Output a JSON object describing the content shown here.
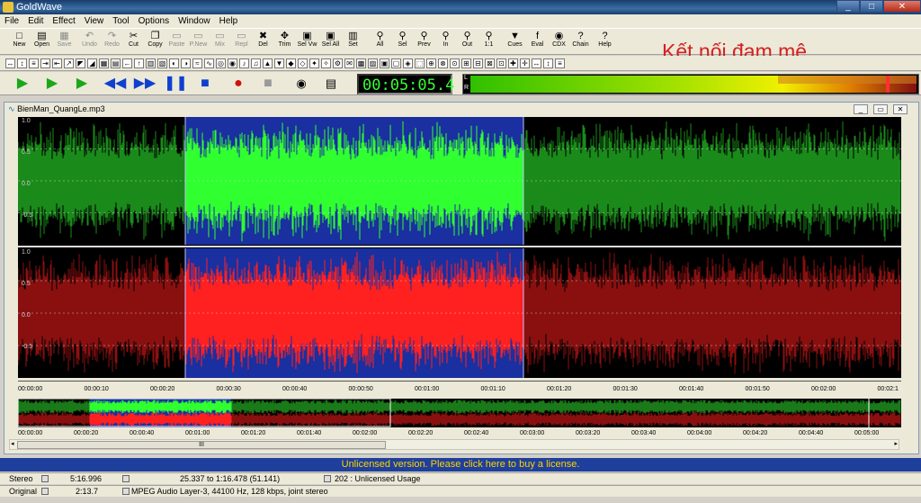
{
  "window": {
    "title": "GoldWave",
    "controls": [
      "_",
      "□",
      "✕"
    ]
  },
  "menu": [
    "File",
    "Edit",
    "Effect",
    "View",
    "Tool",
    "Options",
    "Window",
    "Help"
  ],
  "toolbar": [
    {
      "label": "New",
      "icon": "new-icon",
      "glyph": "□",
      "enabled": true
    },
    {
      "label": "Open",
      "icon": "open-icon",
      "glyph": "▤",
      "enabled": true
    },
    {
      "label": "Save",
      "icon": "save-icon",
      "glyph": "▦",
      "enabled": false
    },
    {
      "label": "Undo",
      "icon": "undo-icon",
      "glyph": "↶",
      "enabled": false
    },
    {
      "label": "Redo",
      "icon": "redo-icon",
      "glyph": "↷",
      "enabled": false
    },
    {
      "label": "Cut",
      "icon": "cut-icon",
      "glyph": "✂",
      "enabled": true
    },
    {
      "label": "Copy",
      "icon": "copy-icon",
      "glyph": "❐",
      "enabled": true
    },
    {
      "label": "Paste",
      "icon": "paste-icon",
      "glyph": "▭",
      "enabled": false
    },
    {
      "label": "P.New",
      "icon": "paste-new-icon",
      "glyph": "▭",
      "enabled": false
    },
    {
      "label": "Mix",
      "icon": "mix-icon",
      "glyph": "▭",
      "enabled": false
    },
    {
      "label": "Repl",
      "icon": "replace-icon",
      "glyph": "▭",
      "enabled": false
    },
    {
      "label": "Del",
      "icon": "delete-icon",
      "glyph": "✖",
      "enabled": true
    },
    {
      "label": "Trim",
      "icon": "trim-icon",
      "glyph": "✥",
      "enabled": true
    },
    {
      "label": "Sel Vw",
      "icon": "select-view-icon",
      "glyph": "▣",
      "enabled": true
    },
    {
      "label": "Sel All",
      "icon": "select-all-icon",
      "glyph": "▣",
      "enabled": true
    },
    {
      "label": "Set",
      "icon": "set-icon",
      "glyph": "▥",
      "enabled": true
    },
    {
      "label": "All",
      "icon": "zoom-all-icon",
      "glyph": "⚲",
      "enabled": true
    },
    {
      "label": "Sel",
      "icon": "zoom-selection-icon",
      "glyph": "⚲",
      "enabled": true
    },
    {
      "label": "Prev",
      "icon": "zoom-previous-icon",
      "glyph": "⚲",
      "enabled": true
    },
    {
      "label": "In",
      "icon": "zoom-in-icon",
      "glyph": "⚲",
      "enabled": true
    },
    {
      "label": "Out",
      "icon": "zoom-out-icon",
      "glyph": "⚲",
      "enabled": true
    },
    {
      "label": "1:1",
      "icon": "zoom-one-to-one-icon",
      "glyph": "⚲",
      "enabled": true
    },
    {
      "label": "Cues",
      "icon": "cues-icon",
      "glyph": "▼",
      "enabled": true
    },
    {
      "label": "Eval",
      "icon": "eval-icon",
      "glyph": "f",
      "enabled": true
    },
    {
      "label": "CDX",
      "icon": "cd-icon",
      "glyph": "◉",
      "enabled": true
    },
    {
      "label": "Chain",
      "icon": "chain-icon",
      "glyph": "?",
      "enabled": true
    },
    {
      "label": "Help",
      "icon": "help-icon",
      "glyph": "?",
      "enabled": true
    }
  ],
  "watermark_text": "Kết nối đam mê",
  "transport": {
    "buttons": [
      {
        "name": "play-button",
        "glyph": "▶",
        "color": "#1aa81a"
      },
      {
        "name": "play-selection-button",
        "glyph": "▶",
        "color": "#1aa81a"
      },
      {
        "name": "play-custom-button",
        "glyph": "▶",
        "color": "#1aa81a"
      },
      {
        "name": "rewind-button",
        "glyph": "◀◀",
        "color": "#1040d0"
      },
      {
        "name": "fast-forward-button",
        "glyph": "▶▶",
        "color": "#1040d0"
      },
      {
        "name": "pause-button",
        "glyph": "❚❚",
        "color": "#1040d0"
      },
      {
        "name": "stop-button",
        "glyph": "■",
        "color": "#1040d0"
      },
      {
        "name": "record-button",
        "glyph": "●",
        "color": "#d01010"
      },
      {
        "name": "record-stop-button",
        "glyph": "■",
        "color": "#9a9a9a"
      }
    ],
    "time": "00:05:05.4",
    "meter_labels": [
      "L",
      "R"
    ]
  },
  "document": {
    "title": "BienMan_QuangLe.mp3",
    "scale_labels": [
      "1.0",
      "0.5",
      "0.0",
      "-0.5"
    ],
    "ruler_labels": [
      "00:00:00",
      "00:00:10",
      "00:00:20",
      "00:00:30",
      "00:00:40",
      "00:00:50",
      "00:01:00",
      "00:01:10",
      "00:01:20",
      "00:01:30",
      "00:01:40",
      "00:01:50",
      "00:02:00",
      "00:02:1"
    ],
    "overview_ruler_labels": [
      "00:00:00",
      "00:00:20",
      "00:00:40",
      "00:01:00",
      "00:01:20",
      "00:01:40",
      "00:02:00",
      "00:02:20",
      "00:02:40",
      "00:03:00",
      "00:03:20",
      "00:03:40",
      "00:04:00",
      "00:04:20",
      "00:04:40",
      "00:05:00"
    ],
    "scroll_thumb": "III"
  },
  "banner": "Unlicensed version. Please click here to buy a license.",
  "status": {
    "row1": {
      "channels": "Stereo",
      "length": "5:16.996",
      "selection": "25.337 to 1:16.478 (51.141)",
      "license": "202 : Unlicensed Usage"
    },
    "row2": {
      "mode": "Original",
      "position": "2:13.7",
      "format": "MPEG Audio Layer-3, 44100 Hz, 128 kbps, joint stereo"
    }
  },
  "colors": {
    "left_channel": "#20c020",
    "right_channel": "#d01818",
    "selection_bg": "#1a2fa0"
  }
}
